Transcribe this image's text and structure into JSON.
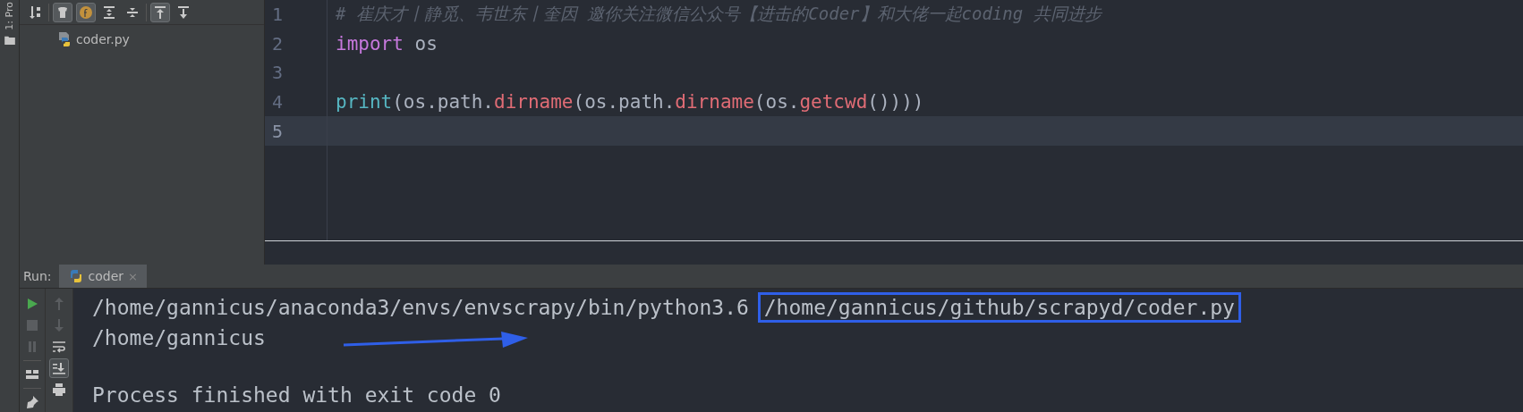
{
  "tool_strip": {
    "label": "1: Pro"
  },
  "project_toolbar": [
    {
      "kind": "sort",
      "on": false
    },
    {
      "kind": "members",
      "on": true
    },
    {
      "kind": "fields",
      "on": true
    },
    {
      "kind": "expand",
      "on": false
    },
    {
      "kind": "collapse",
      "on": false
    },
    {
      "kind": "autoscroll-from",
      "on": true
    },
    {
      "kind": "autoscroll-to",
      "on": false
    }
  ],
  "project_tree": [
    {
      "name": "coder.py",
      "selected": false
    }
  ],
  "editor": {
    "lines": [
      {
        "number": "1",
        "current": false,
        "tokens": [
          {
            "kind": "comment",
            "text": "# 崔庆才丨静觅、韦世东丨奎因 邀你关注微信公众号【进击的Coder】和大佬一起coding 共同进步"
          }
        ]
      },
      {
        "number": "2",
        "current": false,
        "tokens": [
          {
            "kind": "keyword",
            "text": "import"
          },
          {
            "kind": "plain",
            "text": " os"
          }
        ]
      },
      {
        "number": "3",
        "current": false
      },
      {
        "number": "4",
        "current": false,
        "tokens": [
          {
            "kind": "builtin",
            "text": "print"
          },
          {
            "kind": "plain",
            "text": "(os.path."
          },
          {
            "kind": "call",
            "text": "dirname"
          },
          {
            "kind": "plain",
            "text": "(os.path."
          },
          {
            "kind": "call",
            "text": "dirname"
          },
          {
            "kind": "plain",
            "text": "(os."
          },
          {
            "kind": "call",
            "text": "getcwd"
          },
          {
            "kind": "plain",
            "text": "())))"
          }
        ]
      },
      {
        "number": "5",
        "current": true
      }
    ]
  },
  "run_panel": {
    "label": "Run:",
    "tab": {
      "title": "coder",
      "selected": true,
      "close": "×"
    },
    "left_tools": [
      {
        "kind": "run",
        "on": false
      },
      {
        "kind": "stop",
        "on": false
      },
      {
        "kind": "pause",
        "on": false
      },
      {
        "kind": "layout",
        "on": false
      },
      {
        "kind": "pin",
        "on": false
      }
    ],
    "right_tools": [
      {
        "kind": "up",
        "on": false
      },
      {
        "kind": "down",
        "on": false
      },
      {
        "kind": "wrap",
        "on": false
      },
      {
        "kind": "scroll-end",
        "on": true
      },
      {
        "kind": "print",
        "on": false
      }
    ],
    "console": [
      {
        "gap_before": false,
        "segments": [
          {
            "text": "/home/gannicus/anaconda3/envs/envscrapy/bin/python3.6 ",
            "boxed": false
          },
          {
            "text": "/home/gannicus/github/scrapyd/coder.py",
            "boxed": true
          }
        ]
      },
      {
        "gap_before": false,
        "segments": [
          {
            "text": "/home/gannicus",
            "boxed": false
          }
        ]
      },
      {
        "gap_before": true,
        "segments": [
          {
            "text": "Process finished with exit code 0",
            "boxed": false
          }
        ]
      }
    ]
  }
}
